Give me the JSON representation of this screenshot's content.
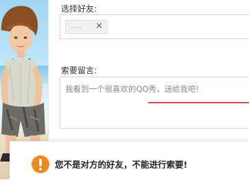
{
  "form": {
    "select_friend_label": "选择好友:",
    "selected_friend": {
      "name": ".....",
      "remove_symbol": "✕"
    },
    "message_label": "索要留言:",
    "message_placeholder": "我看到一个很喜欢的QQ秀，送给我吧!"
  },
  "alert": {
    "icon": "warning-icon",
    "message": "您不是对方的好友，不能进行索要!"
  },
  "colors": {
    "alert_icon": "#f08a1d",
    "validation_line": "#e04a4a"
  },
  "avatar_preview": {
    "icon": "qq-show-avatar"
  }
}
